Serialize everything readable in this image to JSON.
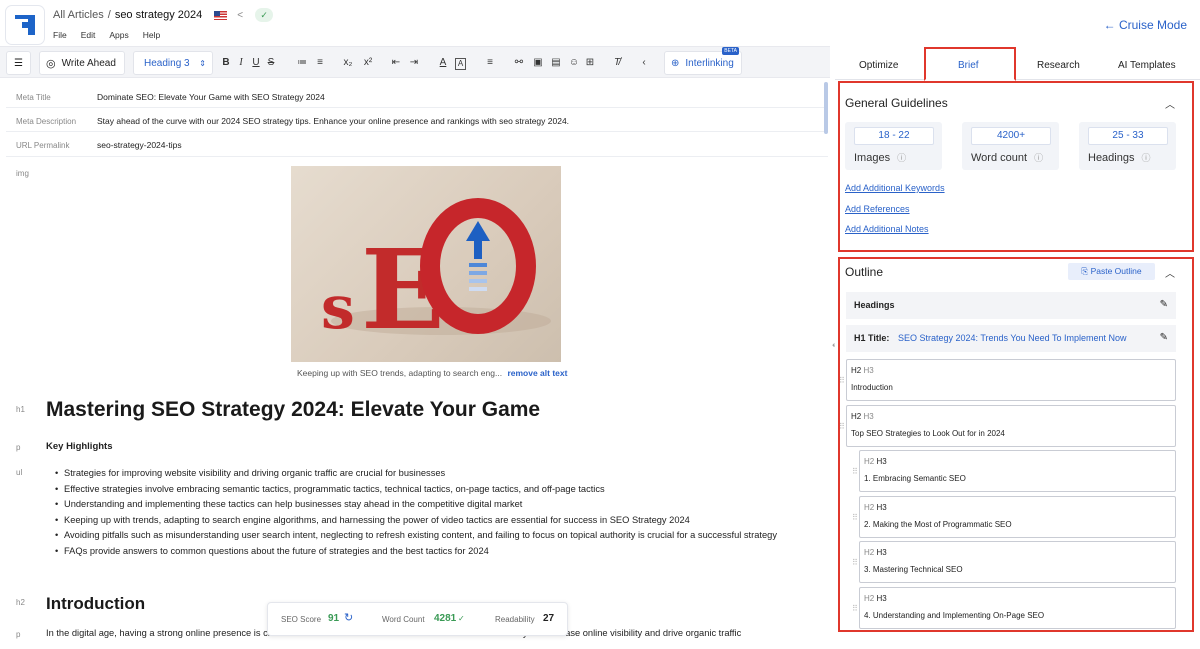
{
  "app": {
    "breadcrumb_root": "All Articles",
    "breadcrumb_sep": "/",
    "article_title": "seo strategy 2024",
    "menus": [
      "File",
      "Edit",
      "Apps",
      "Help"
    ],
    "cruise_mode": "← Cruise Mode"
  },
  "toolbar": {
    "write_ahead": "Write Ahead",
    "heading_select": "Heading 3",
    "interlinking": "Interlinking",
    "beta": "BETA"
  },
  "meta": {
    "title_label": "Meta Title",
    "title_value": "Dominate SEO: Elevate Your Game with SEO Strategy 2024",
    "desc_label": "Meta Description",
    "desc_value": "Stay ahead of the curve with our 2024 SEO strategy tips. Enhance your online presence and rankings with seo strategy 2024.",
    "url_label": "URL Permalink",
    "url_value": "seo-strategy-2024-tips"
  },
  "content": {
    "img_tag": "img",
    "image_caption": "Keeping up with SEO trends, adapting to search eng...",
    "remove_alt": "remove alt text",
    "h1_tag": "h1",
    "h1": "Mastering SEO Strategy 2024: Elevate Your Game",
    "p_tag": "p",
    "key_highlights": "Key Highlights",
    "ul_tag": "ul",
    "bullets": [
      "Strategies for improving website visibility and driving organic traffic are crucial for businesses",
      "Effective strategies involve embracing semantic tactics, programmatic tactics, technical tactics, on-page tactics, and off-page tactics",
      "Understanding and implementing these tactics can help businesses stay ahead in the competitive digital market",
      "Keeping up with trends, adapting to search engine algorithms, and harnessing the power of video tactics are essential for success in SEO Strategy 2024",
      "Avoiding pitfalls such as misunderstanding user search intent, neglecting to refresh existing content, and failing to focus on topical authority is crucial for a successful strategy",
      "FAQs provide answers to common questions about the future of strategies and the best tactics for 2024"
    ],
    "h2_tag": "h2",
    "h2": "Introduction",
    "p2_tag": "p",
    "paragraph": "In the digital age, having a strong online presence is crucial for businesses to succeed. One of the most effective ways to increase online visibility and drive organic traffic"
  },
  "scores": {
    "seo_label": "SEO Score",
    "seo_value": "91",
    "wc_label": "Word Count",
    "wc_value": "4281",
    "read_label": "Readability",
    "read_value": "27"
  },
  "panel": {
    "tabs": [
      "Optimize",
      "Brief",
      "Research",
      "AI Templates"
    ],
    "active_tab": "Brief",
    "guidelines_title": "General Guidelines",
    "stats": [
      {
        "value": "18 - 22",
        "label": "Images"
      },
      {
        "value": "4200+",
        "label": "Word count"
      },
      {
        "value": "25 - 33",
        "label": "Headings"
      }
    ],
    "links": [
      "Add Additional Keywords",
      "Add References",
      "Add Additional Notes"
    ],
    "outline_title": "Outline",
    "paste_outline": "Paste Outline",
    "headings_row": "Headings",
    "h1_label": "H1 Title:",
    "h1_value": "SEO Strategy 2024: Trends You Need To Implement Now",
    "outline": [
      {
        "level": "H2",
        "text": "Introduction"
      },
      {
        "level": "H2",
        "text": "Top SEO Strategies to Look Out for in 2024"
      },
      {
        "level": "H3",
        "text": "1. Embracing Semantic SEO"
      },
      {
        "level": "H3",
        "text": "2. Making the Most of Programmatic SEO"
      },
      {
        "level": "H3",
        "text": "3. Mastering Technical SEO"
      },
      {
        "level": "H3",
        "text": "4. Understanding and Implementing On-Page SEO"
      }
    ]
  },
  "colors": {
    "accent": "#2a62c9",
    "highlight": "#e0372c",
    "score_green": "#3a9a55"
  }
}
